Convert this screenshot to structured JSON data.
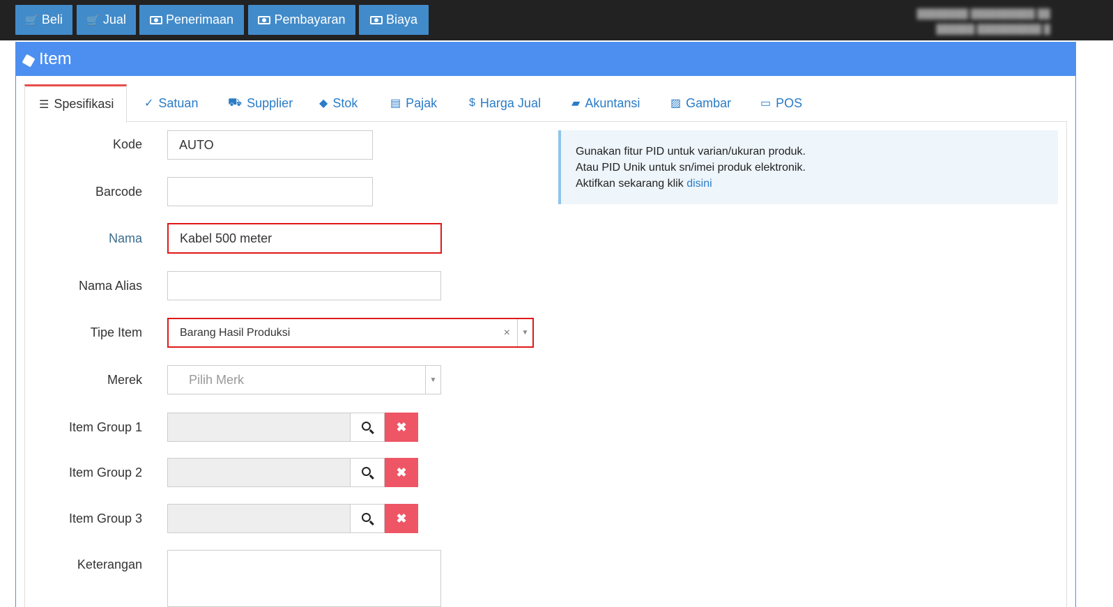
{
  "topbar": {
    "buttons": [
      {
        "label": "Beli",
        "icon": "cart-icon"
      },
      {
        "label": "Jual",
        "icon": "cart-icon"
      },
      {
        "label": "Penerimaan",
        "icon": "cash-icon"
      },
      {
        "label": "Pembayaran",
        "icon": "cash-icon"
      },
      {
        "label": "Biaya",
        "icon": "cash-icon"
      }
    ]
  },
  "panel": {
    "title": "Item",
    "icon": "cube-icon"
  },
  "tabs": [
    {
      "label": "Spesifikasi",
      "icon": "list-icon"
    },
    {
      "label": "Satuan",
      "icon": "check-circle-icon"
    },
    {
      "label": "Supplier",
      "icon": "truck-icon"
    },
    {
      "label": "Stok",
      "icon": "cube-icon"
    },
    {
      "label": "Pajak",
      "icon": "table-icon"
    },
    {
      "label": "Harga Jual",
      "icon": "dollar-icon"
    },
    {
      "label": "Akuntansi",
      "icon": "book-icon"
    },
    {
      "label": "Gambar",
      "icon": "image-icon"
    },
    {
      "label": "POS",
      "icon": "monitor-icon"
    }
  ],
  "form": {
    "kode": {
      "label": "Kode",
      "value": "AUTO"
    },
    "barcode": {
      "label": "Barcode",
      "value": ""
    },
    "nama": {
      "label": "Nama",
      "value": "Kabel 500 meter"
    },
    "nama_alias": {
      "label": "Nama Alias",
      "value": ""
    },
    "tipe_item": {
      "label": "Tipe Item",
      "value": "Barang Hasil Produksi"
    },
    "merek": {
      "label": "Merek",
      "placeholder": "Pilih Merk"
    },
    "item_group_1": {
      "label": "Item Group 1"
    },
    "item_group_2": {
      "label": "Item Group 2"
    },
    "item_group_3": {
      "label": "Item Group 3"
    },
    "keterangan": {
      "label": "Keterangan"
    }
  },
  "info": {
    "line1": "Gunakan fitur PID untuk varian/ukuran produk.",
    "line2": "Atau PID Unik untuk sn/imei produk elektronik.",
    "line3_prefix": "Aktifkan sekarang klik",
    "link": "disini"
  },
  "colors": {
    "topbar_bg": "#222222",
    "button_blue": "#428bca",
    "panel_blue": "#4c8ff0",
    "highlight_red": "#e01818",
    "delete_red": "#ee5565"
  }
}
